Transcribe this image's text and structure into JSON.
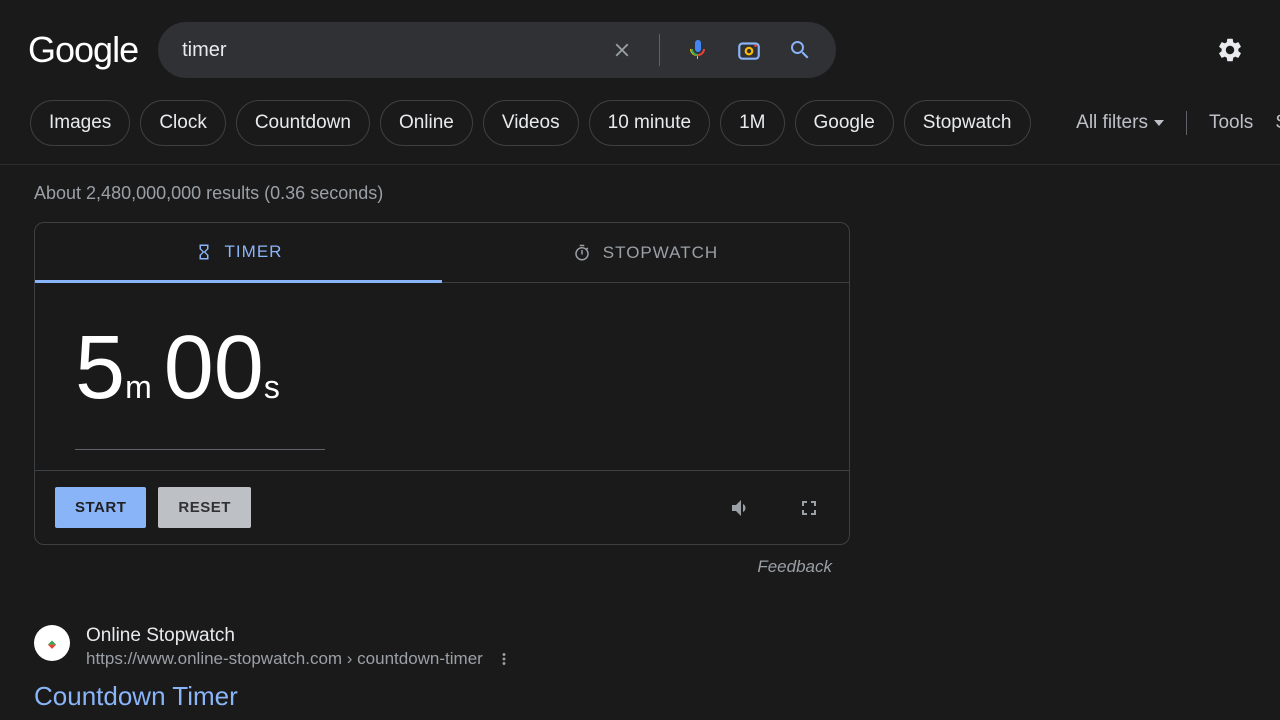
{
  "header": {
    "logo": "Google",
    "search_value": "timer"
  },
  "chips": [
    "Images",
    "Clock",
    "Countdown",
    "Online",
    "Videos",
    "10 minute",
    "1M",
    "Google",
    "Stopwatch"
  ],
  "filters": {
    "all_filters": "All filters",
    "tools": "Tools",
    "safe": "S"
  },
  "stats": "About 2,480,000,000 results (0.36 seconds)",
  "widget": {
    "tab_timer": "TIMER",
    "tab_stopwatch": "STOPWATCH",
    "minutes_value": "5",
    "minutes_unit": "m",
    "seconds_value": "00",
    "seconds_unit": "s",
    "start": "START",
    "reset": "RESET"
  },
  "feedback": "Feedback",
  "result": {
    "site": "Online Stopwatch",
    "url": "https://www.online-stopwatch.com › countdown-timer",
    "title": "Countdown Timer"
  }
}
